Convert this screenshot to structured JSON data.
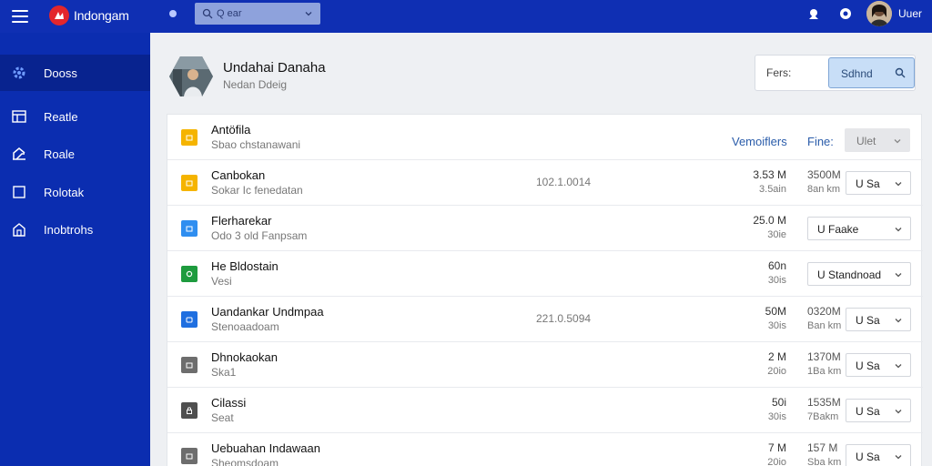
{
  "app": {
    "brand": "Indongam",
    "user_name": "Uuer"
  },
  "search": {
    "placeholder": "Q ear"
  },
  "sidebar": {
    "items": [
      {
        "label": "Dooss",
        "icon": "gear-icon",
        "active": true
      },
      {
        "label": "Reatle",
        "icon": "grid-icon",
        "active": false
      },
      {
        "label": "Roale",
        "icon": "home-icon",
        "active": false
      },
      {
        "label": "Rolotak",
        "icon": "square-icon",
        "active": false
      },
      {
        "label": "Inobtrohs",
        "icon": "house-icon",
        "active": false
      }
    ]
  },
  "header": {
    "title": "Undahai Danaha",
    "subtitle": "Nedan Ddeig"
  },
  "filter": {
    "label": "Fers:",
    "button_label": "Sdhnd"
  },
  "list_header": {
    "title": "Antöfila",
    "subtitle": "Sbao chstanawani",
    "link_label": "Vemoiflers",
    "fine_label": "Fine:",
    "dropdown": "Ulet",
    "icon_color": "#f5b400"
  },
  "rows": [
    {
      "title": "Canbokan",
      "subtitle": "Sokar Ic fenedatan",
      "code": "102.1.0014",
      "size_a": "3.53 M",
      "size_b": "3.5ain",
      "mem_a": "3500M",
      "mem_b": "8an km",
      "dropdown": "U  Sa",
      "icon_color": "#f5b400"
    },
    {
      "title": "Flerharekar",
      "subtitle": "Odo 3 old Fanpsam",
      "code": "",
      "size_a": "25.0 M",
      "size_b": "30ie",
      "mem_a": "",
      "mem_b": "",
      "dropdown": "U  Faake",
      "icon_color": "#2f8ef0"
    },
    {
      "title": "He Bldostain",
      "subtitle": "Vesi",
      "code": "",
      "size_a": "60n",
      "size_b": "30is",
      "mem_a": "",
      "mem_b": "",
      "dropdown": "U  Standnoad",
      "icon_color": "#1e9b3e"
    },
    {
      "title": "Uandankar Undmpaa",
      "subtitle": "Stenoaadoam",
      "code": "221.0.5094",
      "size_a": "50M",
      "size_b": "30is",
      "mem_a": "0320M",
      "mem_b": "Ban km",
      "dropdown": "U  Sa",
      "icon_color": "#1f6fe0"
    },
    {
      "title": "Dhnokaokan",
      "subtitle": "Ska1",
      "code": "",
      "size_a": "2 M",
      "size_b": "20io",
      "mem_a": "1370M",
      "mem_b": "1Ba km",
      "dropdown": "U  Sa",
      "icon_color": "#6d6d6d"
    },
    {
      "title": "Cilassi",
      "subtitle": "Seat",
      "code": "",
      "size_a": "50i",
      "size_b": "30is",
      "mem_a": "1535M",
      "mem_b": "7Bakm",
      "dropdown": "U  Sa",
      "icon_color": "#4f4f4f"
    },
    {
      "title": "Uebuahan Indawaan",
      "subtitle": "Sheomsdoam",
      "code": "",
      "size_a": "7 M",
      "size_b": "20io",
      "mem_a": "157 M",
      "mem_b": "Sba km",
      "dropdown": "U  Sa",
      "icon_color": "#6d6d6d"
    }
  ],
  "colors": {
    "topbar": "#0f2fb3",
    "sidebar": "#0b2db0",
    "sidebar_active": "#08238f",
    "accent": "#2a5caa"
  }
}
